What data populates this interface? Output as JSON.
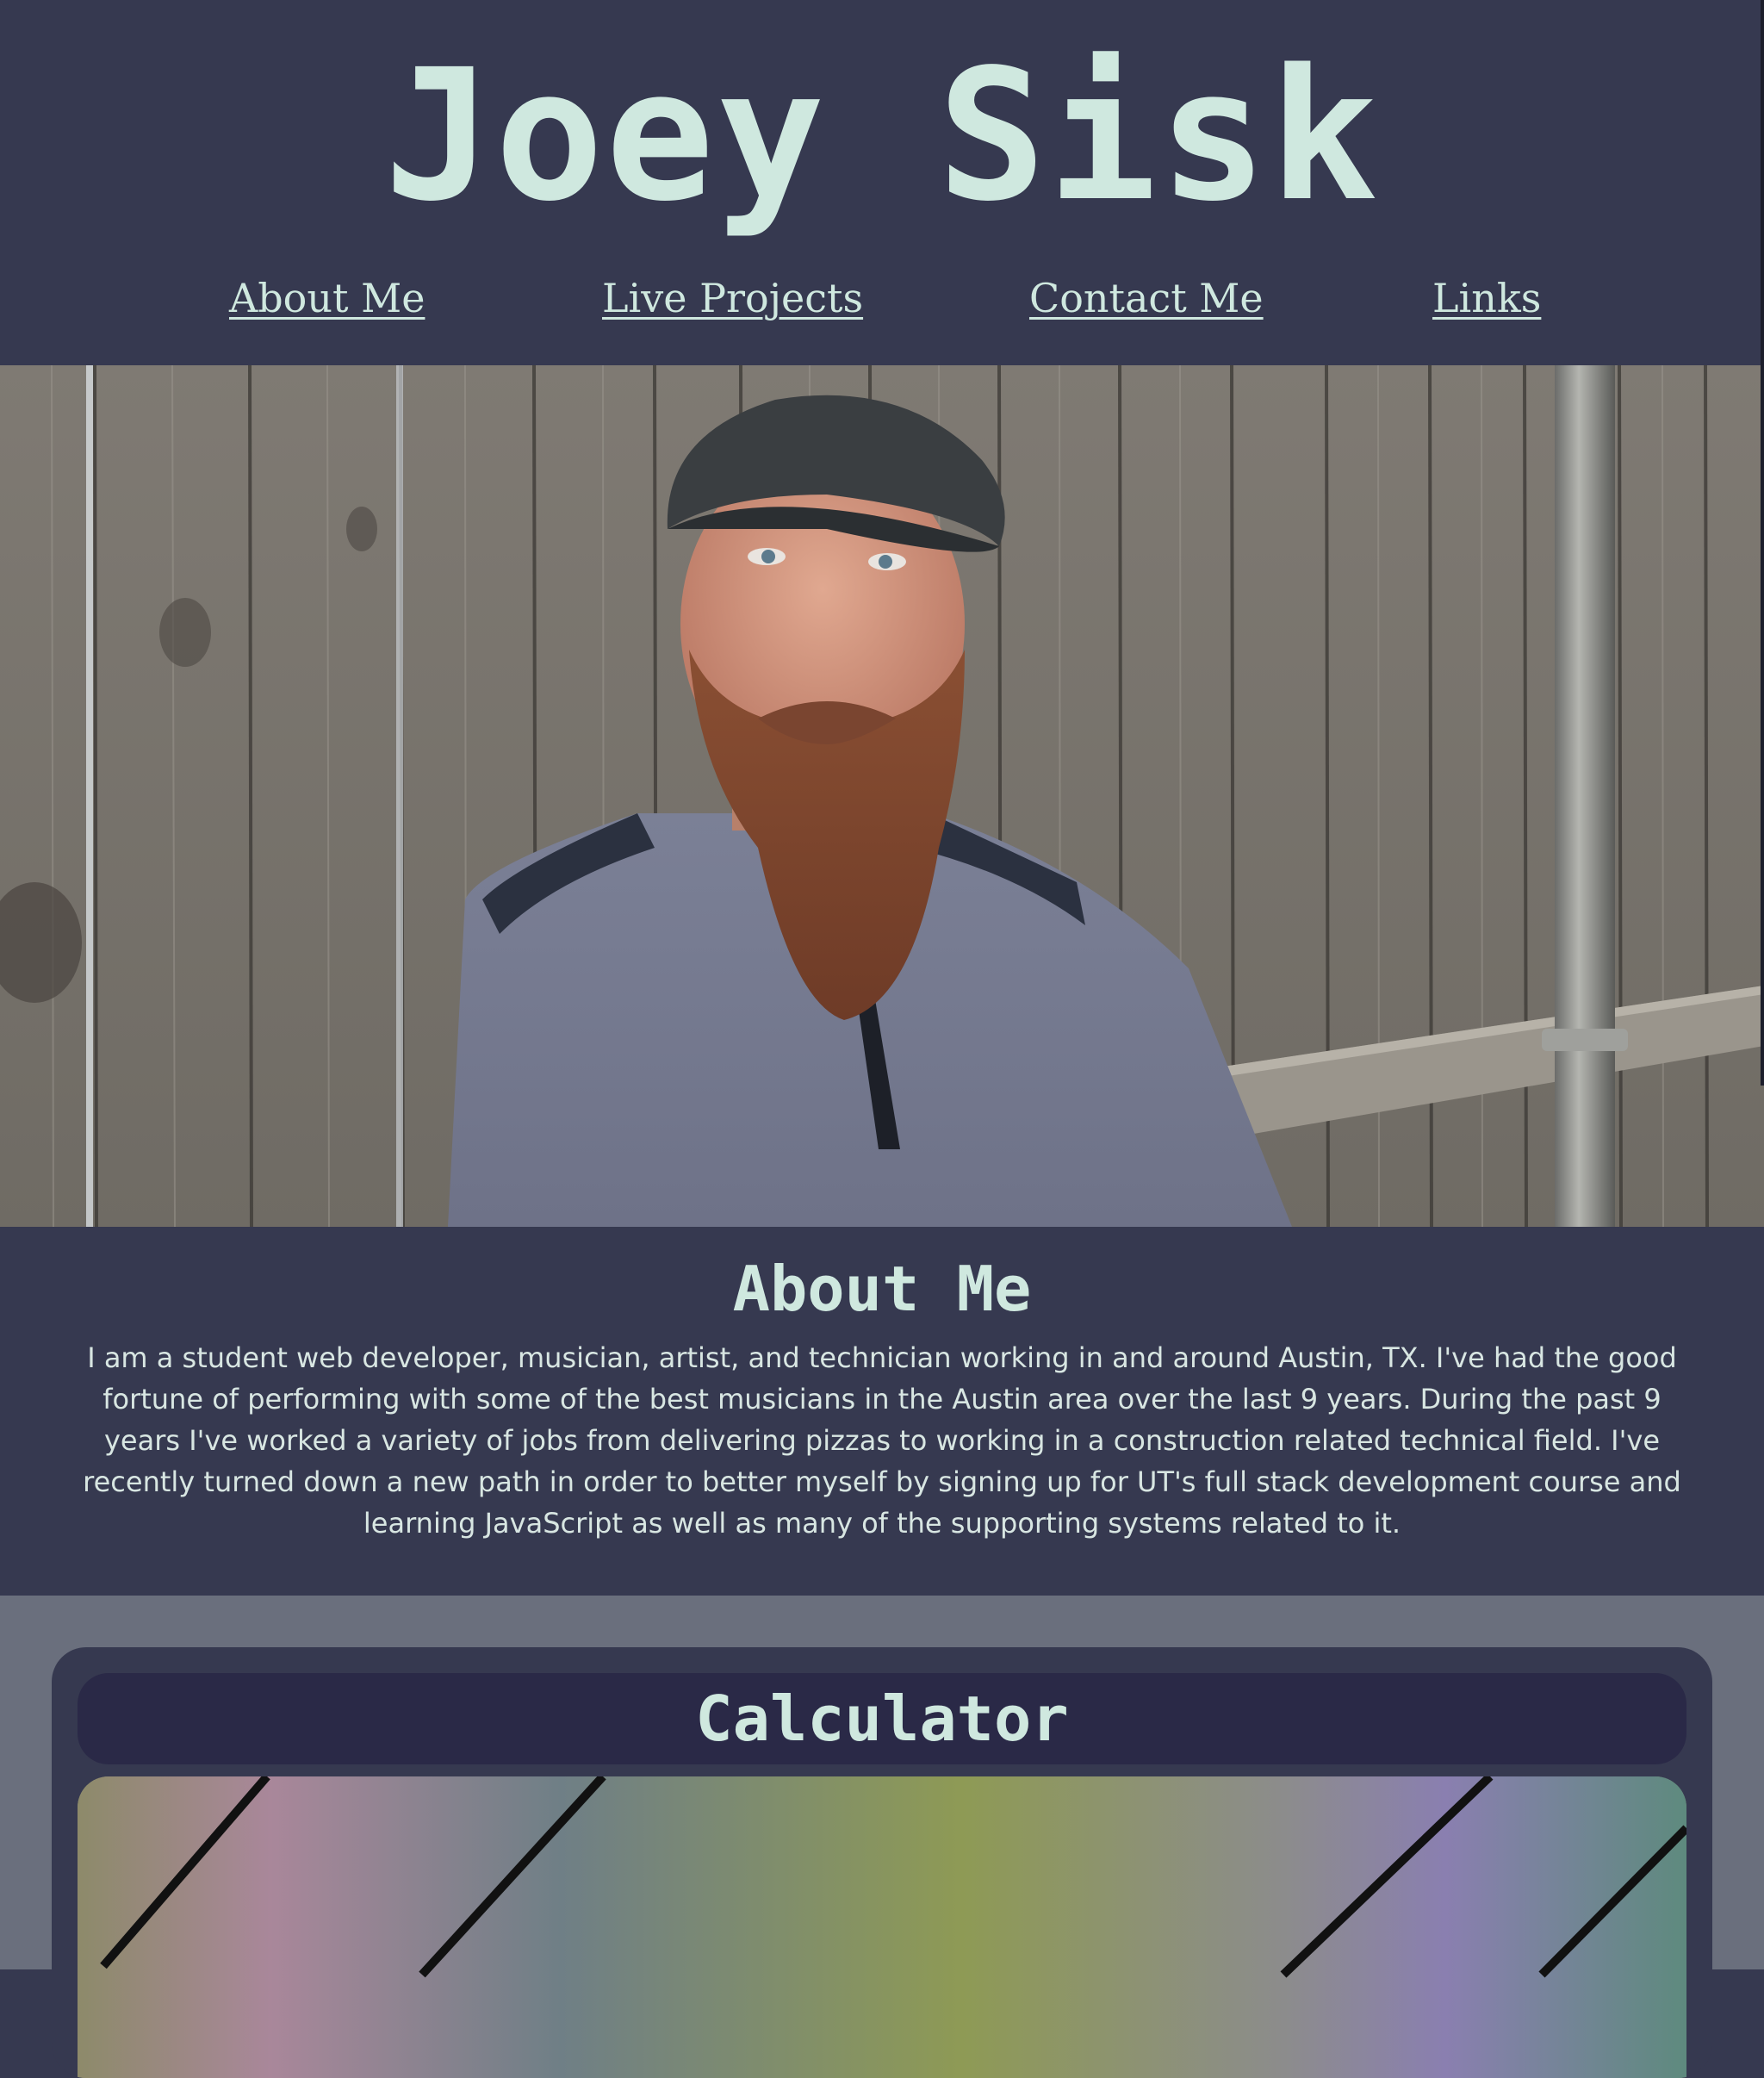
{
  "site": {
    "title": "Joey Sisk"
  },
  "nav": {
    "items": [
      {
        "label": "About Me"
      },
      {
        "label": "Live Projects"
      },
      {
        "label": "Contact Me"
      },
      {
        "label": "Links"
      }
    ]
  },
  "hero": {
    "image": "portrait-photo"
  },
  "about": {
    "heading": "About Me",
    "text": "I am a student web developer, musician, artist, and technician working in and around Austin, TX. I've had the good fortune of performing with some of the best musicians in the Austin area over the last 9 years. During the past 9 years I've worked a variety of jobs from delivering pizzas to working in a construction related technical field. I've recently turned down a new path in order to better myself by signing up for UT's full stack development course and learning JavaScript as well as many of the supporting systems related to it."
  },
  "projects": {
    "items": [
      {
        "title": "Calculator",
        "image": "calculator-screenshot"
      }
    ]
  },
  "colors": {
    "background": "#363950",
    "accent_text": "#cfe8df",
    "projects_background": "#6a6f7d",
    "card_header": "#2a2947"
  }
}
